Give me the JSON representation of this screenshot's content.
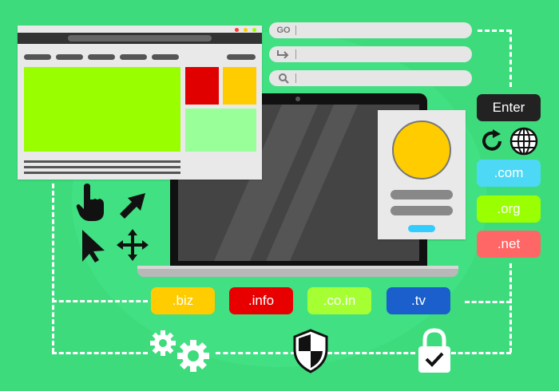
{
  "address_bars": [
    {
      "icon": "go",
      "label": "GO"
    },
    {
      "icon": "arrow-right-icon",
      "label": "↦"
    },
    {
      "icon": "search-icon",
      "label": "🔍"
    }
  ],
  "enter_key": {
    "label": "Enter"
  },
  "right_domains": [
    {
      "label": ".com",
      "color": "#4dd9f5"
    },
    {
      "label": ".org",
      "color": "#9aff00"
    },
    {
      "label": ".net",
      "color": "#ff6666"
    }
  ],
  "bottom_domains": [
    {
      "label": ".biz",
      "color": "#ffcc00"
    },
    {
      "label": ".info",
      "color": "#e80000"
    },
    {
      "label": ".co.in",
      "color": "#a6ff33"
    },
    {
      "label": ".tv",
      "color": "#1a5fcc"
    }
  ],
  "colors": {
    "background": "#3edb7d",
    "browser_main_block": "#99ff00",
    "browser_red_block": "#e00000",
    "browser_yellow_block": "#ffcc00",
    "browser_green_block": "#99ff99",
    "avatar": "#ffcc00"
  },
  "icons": [
    "hand-pointer-icon",
    "arrow-cursor-icon",
    "pointer-icon",
    "move-icon",
    "refresh-icon",
    "globe-icon",
    "gears-icon",
    "shield-icon",
    "lock-check-icon"
  ]
}
